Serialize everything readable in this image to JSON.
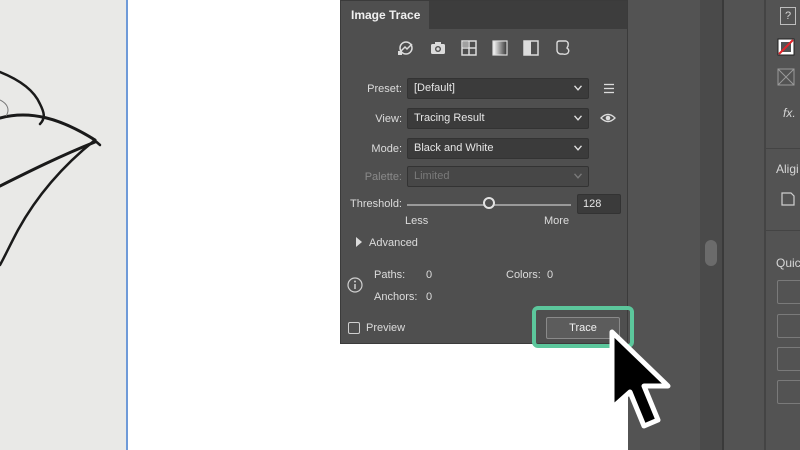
{
  "panel": {
    "tab_title": "Image Trace",
    "preset_icons": [
      "auto-color-icon",
      "camera-icon",
      "grid-icon",
      "gradient-icon",
      "half-fill-icon",
      "outline-icon"
    ],
    "preset": {
      "label": "Preset:",
      "value": "[Default]"
    },
    "view": {
      "label": "View:",
      "value": "Tracing Result"
    },
    "mode": {
      "label": "Mode:",
      "value": "Black and White"
    },
    "palette": {
      "label": "Palette:",
      "value": "Limited"
    },
    "threshold": {
      "label": "Threshold:",
      "value": "128",
      "min_label": "Less",
      "max_label": "More",
      "level": 128,
      "max": 255
    },
    "advanced_label": "Advanced",
    "stats": {
      "paths_label": "Paths:",
      "paths_value": "0",
      "colors_label": "Colors:",
      "colors_value": "0",
      "anchors_label": "Anchors:",
      "anchors_value": "0"
    },
    "preview_label": "Preview",
    "trace_button": "Trace"
  },
  "dock": {
    "help_label": "?",
    "fx_label": "fx.",
    "align_label": "Aligi",
    "quick_label": "Quic"
  },
  "colors": {
    "panel_bg": "#4f4f4f",
    "highlight": "#5cc79c",
    "artboard_edge": "#6f9ad8"
  }
}
